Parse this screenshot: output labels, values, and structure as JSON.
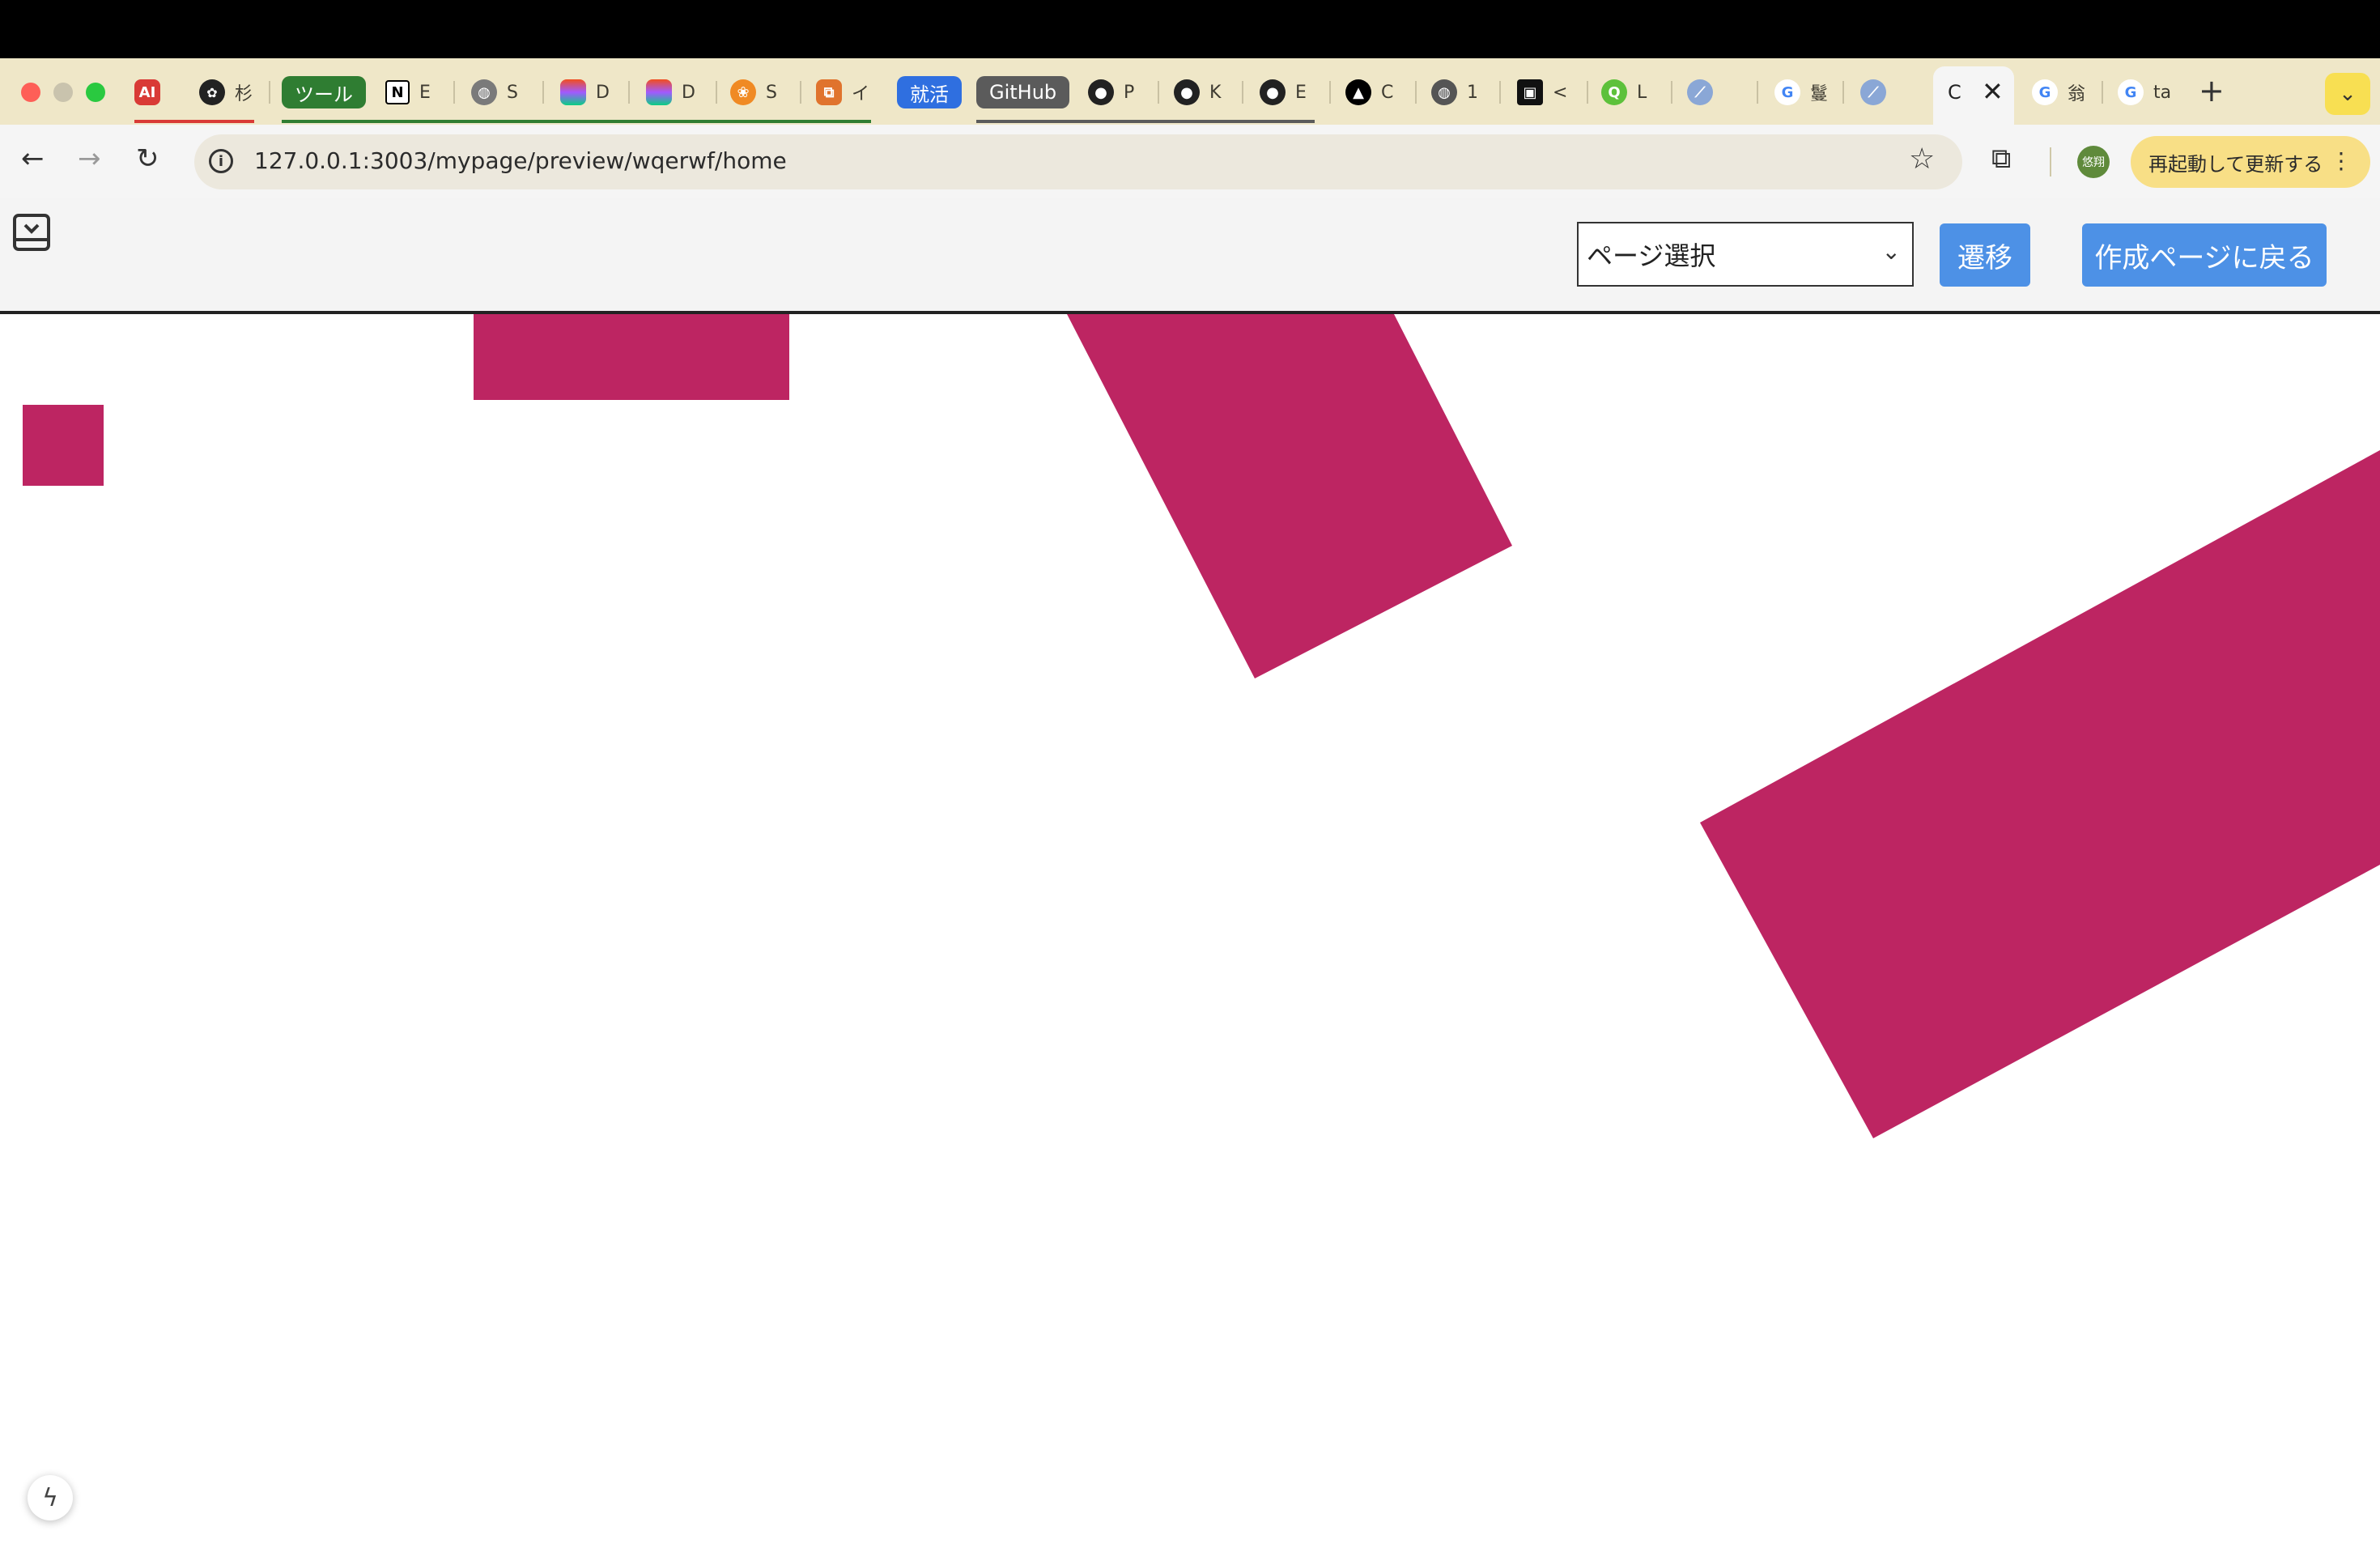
{
  "browser": {
    "tabs": [
      {
        "icon": "ai-icon",
        "label": "AI",
        "icon_color": "#d93a36"
      },
      {
        "icon": "openai-icon",
        "label": "杉"
      },
      {
        "icon": "group-chip",
        "label": "ツール",
        "chip_color": "#2f7d32"
      },
      {
        "icon": "notion-icon",
        "label": "E"
      },
      {
        "icon": "globe-icon",
        "label": "S"
      },
      {
        "icon": "figma-icon",
        "label": "D"
      },
      {
        "icon": "figma-icon",
        "label": "D"
      },
      {
        "icon": "tool-icon",
        "label": "S"
      },
      {
        "icon": "app-icon",
        "label": "イ"
      },
      {
        "icon": "group-chip",
        "label": "就活",
        "chip_color": "#2f6fe0"
      },
      {
        "icon": "group-chip",
        "label": "GitHub",
        "chip_color": "#5b5b5b"
      },
      {
        "icon": "github-icon",
        "label": "P"
      },
      {
        "icon": "github-icon",
        "label": "K"
      },
      {
        "icon": "github-icon",
        "label": "E"
      },
      {
        "icon": "vercel-icon",
        "label": "C"
      },
      {
        "icon": "globe-icon",
        "label": "1"
      },
      {
        "icon": "code-icon",
        "label": "<"
      },
      {
        "icon": "search-icon",
        "label": "L"
      },
      {
        "icon": "pen-icon",
        "label": ""
      },
      {
        "icon": "google-icon",
        "label": "鬘"
      },
      {
        "icon": "pen-icon",
        "label": ""
      }
    ],
    "active_tab": {
      "label": "C",
      "close": "✕"
    },
    "extra_tabs": [
      {
        "icon": "google-icon",
        "label": "翁"
      },
      {
        "icon": "google-icon",
        "label": "ta"
      }
    ],
    "new_tab": "+",
    "url": "127.0.0.1:3003/mypage/preview/wqerwf/home",
    "avatar_text": "悠翔",
    "relaunch_label": "再起動して更新する"
  },
  "app": {
    "page_select": {
      "label": "ページ選択"
    },
    "go_button": "遷移",
    "back_button": "作成ページに戻る"
  },
  "canvas": {
    "shape_color": "#bd2562"
  }
}
